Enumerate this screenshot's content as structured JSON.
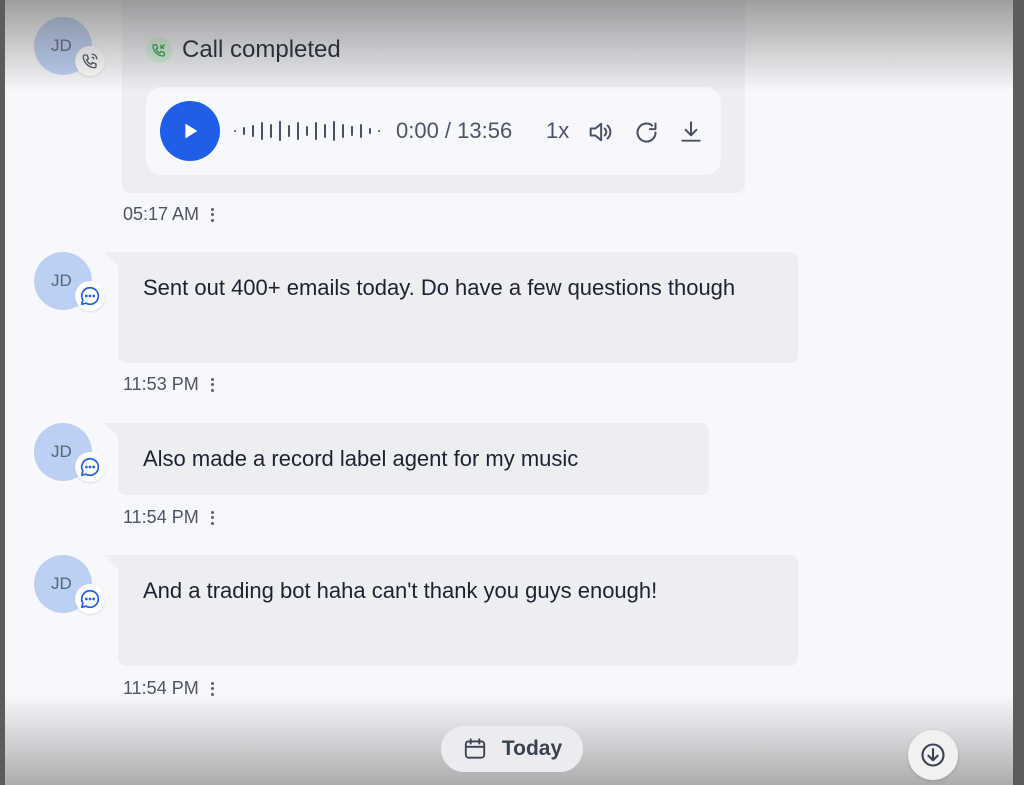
{
  "call": {
    "initials": "JD",
    "status": "Call completed",
    "player": {
      "time_display": "0:00 / 13:56",
      "speed": "1x",
      "progress": 0
    },
    "timestamp": "05:17 AM"
  },
  "messages": [
    {
      "initials": "JD",
      "text": "Sent out 400+ emails today. Do have a few questions though",
      "timestamp": "11:53 PM"
    },
    {
      "initials": "JD",
      "text": "Also made a record label agent for my music",
      "timestamp": "11:54 PM"
    },
    {
      "initials": "JD",
      "text": "And a trading bot haha can't thank you guys enough!",
      "timestamp": "11:54 PM"
    }
  ],
  "footer": {
    "date_label": "Today"
  },
  "colors": {
    "accent": "#1f5ee6",
    "bubble": "#eceef2",
    "avatar": "#bcd0f3",
    "call_success": "#2e9c4a"
  },
  "icons": {
    "call_badge": "phone-call-icon",
    "message_badge": "chat-bubble-icon",
    "call_status": "phone-incoming-icon",
    "play": "play-icon",
    "volume": "volume-icon",
    "replay": "refresh-icon",
    "download": "download-icon",
    "calendar": "calendar-icon",
    "scroll": "arrow-down-circle-icon"
  }
}
